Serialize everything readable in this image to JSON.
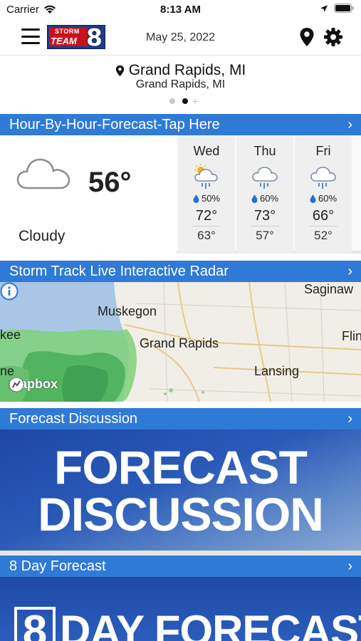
{
  "status_bar": {
    "carrier": "Carrier",
    "time": "8:13 AM"
  },
  "header": {
    "logo_line1": "STORM",
    "logo_line2": "TEAM",
    "logo_number": "8",
    "date": "May 25, 2022"
  },
  "location": {
    "name": "Grand Rapids, MI",
    "subtitle": "Grand Rapids, MI",
    "page_count": 2,
    "active_page": 1
  },
  "sections": {
    "hourly": "Hour-By-Hour-Forecast-Tap Here",
    "radar": "Storm Track Live Interactive Radar",
    "discussion": "Forecast Discussion",
    "eight_day": "8 Day Forecast"
  },
  "current": {
    "icon": "cloud-icon",
    "temperature": "56°",
    "condition": "Cloudy"
  },
  "forecast": [
    {
      "day": "Wed",
      "icon": "partly-sunny-rain-icon",
      "precip": "50%",
      "high": "72°",
      "low": "63°"
    },
    {
      "day": "Thu",
      "icon": "rain-icon",
      "precip": "60%",
      "high": "73°",
      "low": "57°"
    },
    {
      "day": "Fri",
      "icon": "rain-icon",
      "precip": "60%",
      "high": "66°",
      "low": "52°"
    }
  ],
  "radar_map": {
    "labels": [
      "Saginaw",
      "Muskegon",
      "kee",
      "Grand Rapids",
      "Flin",
      "ne",
      "Lansing"
    ],
    "attribution": "mapbox"
  },
  "promos": {
    "discussion_line1": "FORECAST",
    "discussion_line2": "DISCUSSION",
    "eight_day_number": "8",
    "eight_day_text": "DAY FORECAST"
  },
  "colors": {
    "section_bar": "#2f7ad6",
    "precip_drop": "#1e73d2",
    "promo_blue": "#1d47a5"
  }
}
